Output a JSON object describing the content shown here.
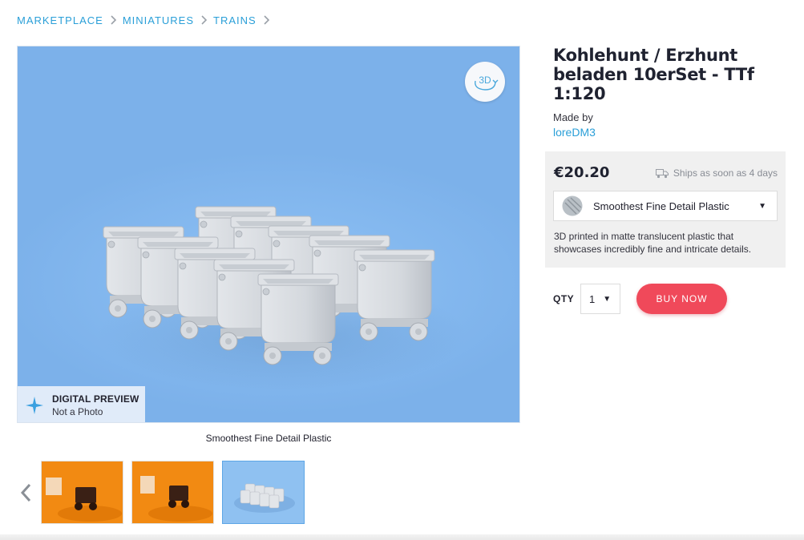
{
  "breadcrumb": [
    {
      "label": "MARKETPLACE"
    },
    {
      "label": "MINIATURES"
    },
    {
      "label": "TRAINS"
    }
  ],
  "viewer": {
    "view_3d_label": "3D",
    "preview_badge": {
      "title": "DIGITAL PREVIEW",
      "subtitle": "Not a Photo"
    },
    "caption": "Smoothest Fine Detail Plastic"
  },
  "thumbnails": [
    {
      "name": "orange-photo-1",
      "active": false
    },
    {
      "name": "orange-photo-2",
      "active": false
    },
    {
      "name": "blue-render",
      "active": true
    }
  ],
  "product": {
    "title": "Kohlehunt / Erzhunt beladen 10erSet - TTf 1:120",
    "made_by_label": "Made by",
    "maker": "loreDM3",
    "price": "€20.20",
    "ships_text": "Ships as soon as 4 days",
    "material": {
      "selected": "Smoothest Fine Detail Plastic",
      "description": "3D printed in matte translucent plastic that showcases incredibly fine and intricate details."
    },
    "qty_label": "QTY",
    "qty_value": "1",
    "buy_label": "BUY NOW"
  },
  "colors": {
    "accent_link": "#2a9fd8",
    "buy_button": "#f0495a",
    "viewer_background": "#86baf0"
  },
  "icons": [
    "chevron-right-icon",
    "rotate-3d-icon",
    "sparkle-icon",
    "chevron-left-icon",
    "truck-icon",
    "caret-down-icon"
  ]
}
